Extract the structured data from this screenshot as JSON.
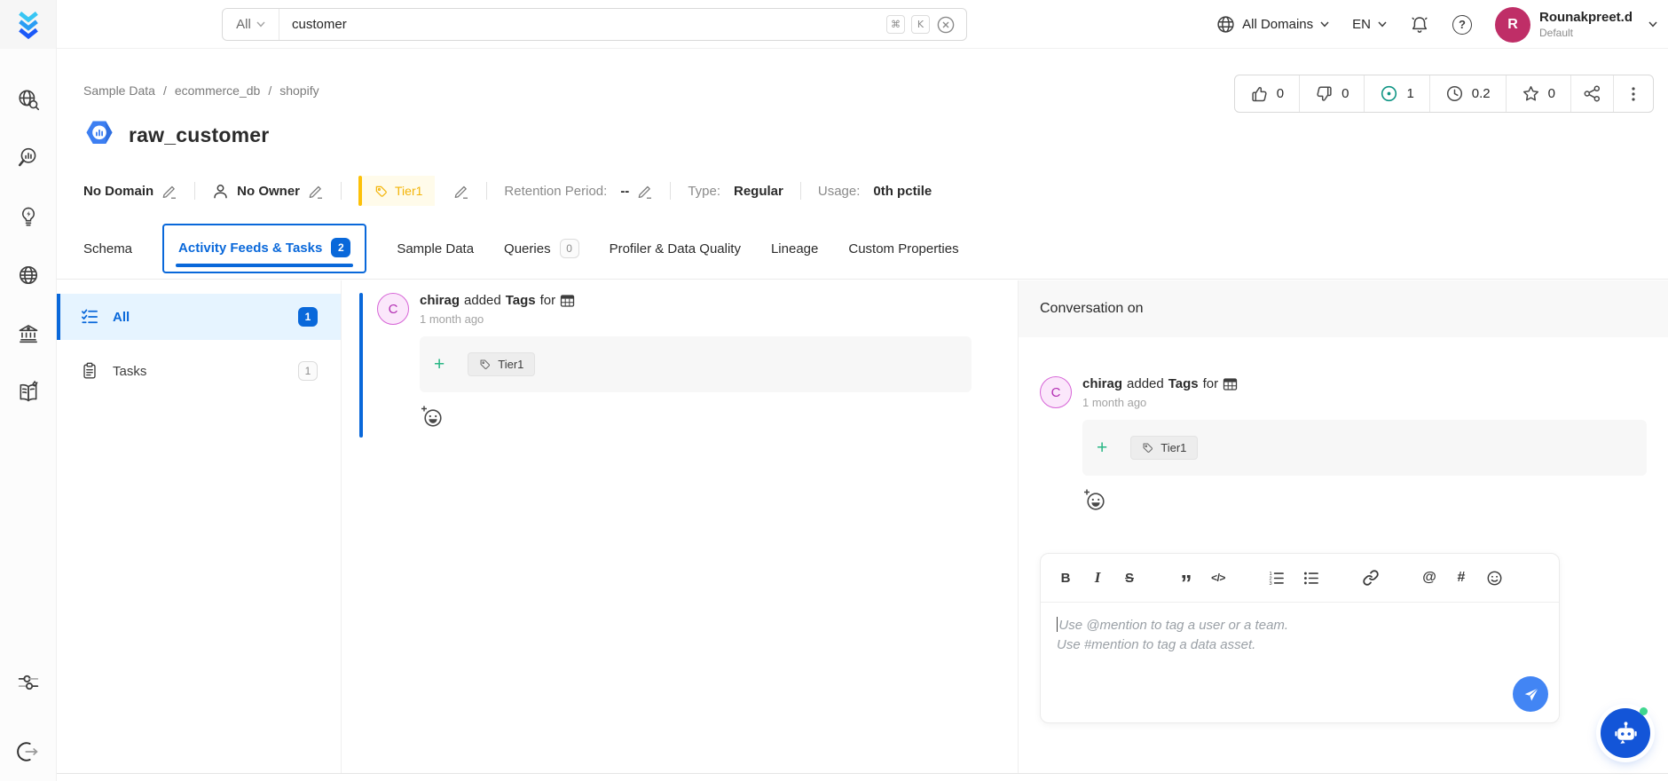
{
  "topbar": {
    "search": {
      "scope": "All",
      "query": "customer",
      "key_cmd": "⌘",
      "key_k": "K"
    },
    "domains_label": "All Domains",
    "language": "EN",
    "user": {
      "initial": "R",
      "name": "Rounakpreet.d",
      "team": "Default"
    }
  },
  "breadcrumb": {
    "items": [
      "Sample Data",
      "ecommerce_db",
      "shopify"
    ],
    "separator": "/"
  },
  "entity": {
    "title": "raw_customer",
    "stats": {
      "upvotes": "0",
      "downvotes": "0",
      "conversations": "1",
      "version": "0.2",
      "stars": "0"
    },
    "meta": {
      "domain": "No Domain",
      "owner": "No Owner",
      "tier": "Tier1",
      "retention_label": "Retention Period:",
      "retention_value": "--",
      "type_label": "Type:",
      "type_value": "Regular",
      "usage_label": "Usage:",
      "usage_value": "0th pctile"
    }
  },
  "tabs": [
    {
      "label": "Schema"
    },
    {
      "label": "Activity Feeds & Tasks",
      "badge": "2"
    },
    {
      "label": "Sample Data"
    },
    {
      "label": "Queries",
      "badge": "0"
    },
    {
      "label": "Profiler & Data Quality"
    },
    {
      "label": "Lineage"
    },
    {
      "label": "Custom Properties"
    }
  ],
  "feed_nav": {
    "all": {
      "label": "All",
      "count": "1"
    },
    "tasks": {
      "label": "Tasks",
      "count": "1"
    }
  },
  "feed": {
    "author_initial": "C",
    "author": "chirag",
    "action": "added",
    "target": "Tags",
    "preposition": "for",
    "timestamp": "1 month ago",
    "add_label": "+",
    "tag": "Tier1"
  },
  "conversation": {
    "header": "Conversation on",
    "item": {
      "author_initial": "C",
      "author": "chirag",
      "action": "added",
      "target": "Tags",
      "preposition": "for",
      "timestamp": "1 month ago",
      "add_label": "+",
      "tag": "Tier1"
    }
  },
  "editor": {
    "placeholder_line1": "Use @mention to tag a user or a team.",
    "placeholder_line2": "Use #mention to tag a data asset.",
    "toolbar": [
      "bold",
      "italic",
      "strikethrough",
      "blockquote",
      "code-block",
      "ordered-list",
      "bullet-list",
      "link",
      "mention",
      "hashtag",
      "emoji"
    ],
    "bold_label": "B",
    "italic_label": "I",
    "strike_label": "S",
    "quote_label": "”",
    "code_label": "</>",
    "mention_label": "@",
    "hashtag_label": "#"
  },
  "rail": {
    "items": [
      "explore",
      "observability",
      "insights",
      "domains",
      "govern",
      "glossary"
    ],
    "bottom": [
      "settings",
      "logout"
    ]
  },
  "colors": {
    "primary": "#0968da",
    "tier": "#fdc108",
    "teal": "#0f9584",
    "avatar_user": "#bf2e67",
    "avatar_author": "#b32eb3",
    "send": "#4285f4",
    "bot": "#1355d8"
  }
}
